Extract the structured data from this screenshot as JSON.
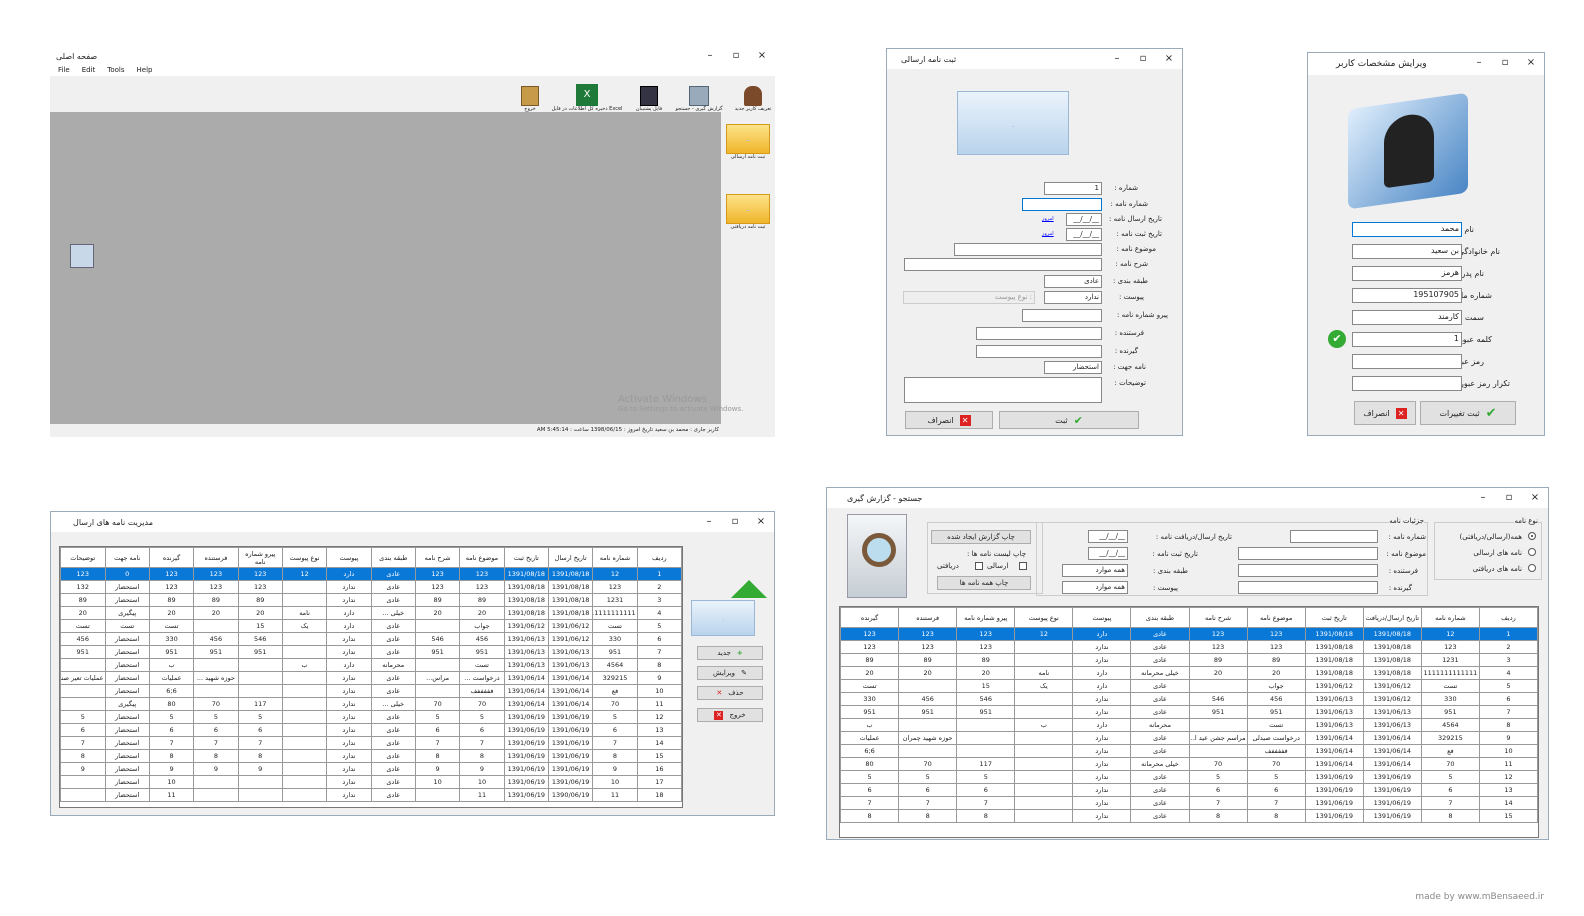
{
  "main": {
    "title": "صفحه اصلی",
    "menu": [
      "File",
      "Edit",
      "Tools",
      "Help"
    ],
    "toolbar": [
      "تعریف کاربر جدید",
      "گزارش گیری - جستجو",
      "فایل پشتیبان",
      "ذخیره کل اطلاعات در فایل Excel",
      "خروج"
    ],
    "side": [
      "ثبت نامه ارسالی",
      "ثبت نامه دریافتی"
    ],
    "watermark1": "Activate Windows",
    "watermark2": "Go to Settings to activate Windows.",
    "status": "کاربر جاری :  محمد بن سعید   تاریخ امروز : 1398/06/15   ساعت : 5:45:14 AM"
  },
  "sendForm": {
    "title": "ثبت نامه ارسالی",
    "labels": [
      "شماره :",
      "شماره نامه :",
      "تاریخ ارسال نامه :",
      "تاریخ ثبت نامه :",
      "موضوع نامه :",
      "شرح نامه :",
      "طبقه بندی :",
      "پیوست :",
      "پیرو شماره نامه :",
      "فرستنده :",
      "گیرنده :",
      "نامه جهت :",
      "توضیحات :"
    ],
    "values": {
      "number": "1",
      "date1": "__/__/__",
      "date2": "__/__/__",
      "classification": "عادی",
      "attach": "ندارد",
      "attachType": "نوع پیوست :",
      "purpose": "استحضار",
      "today": "امروز"
    },
    "submit": "ثبت",
    "cancel": "انصراف"
  },
  "userForm": {
    "title": "ویرایش مشخصات کاربر",
    "labels": [
      "نام :",
      "نام خانوادگی :",
      "نام پدر :",
      "شماره ملی :",
      "سمت :",
      "کلمه عبور :",
      "رمز عبور :",
      "تکرار رمز عبور :"
    ],
    "values": [
      "محمد",
      "بن سعید",
      "هرمز",
      "195107905",
      "کارمند",
      "1",
      "",
      ""
    ],
    "submit": "ثبت تغییرات",
    "cancel": "انصراف"
  },
  "mgmt": {
    "title": "مدیریت نامه های ارسال",
    "headers": [
      "ردیف",
      "شماره نامه",
      "تاریخ ارسال",
      "تاریخ ثبت",
      "موضوع نامه",
      "شرح نامه",
      "طبقه بندی",
      "پیوست",
      "نوع پیوست",
      "پیرو شماره نامه",
      "فرستنده",
      "گیرنده",
      "نامه جهت",
      "توضیحات"
    ],
    "rows": [
      [
        "1",
        "12",
        "1391/08/18",
        "1391/08/18",
        "123",
        "123",
        "عادی",
        "دارد",
        "12",
        "123",
        "123",
        "123",
        "0",
        "123"
      ],
      [
        "2",
        "123",
        "1391/08/18",
        "1391/08/18",
        "123",
        "123",
        "عادی",
        "ندارد",
        "",
        "123",
        "123",
        "123",
        "استحضار",
        "132"
      ],
      [
        "3",
        "1231",
        "1391/08/18",
        "1391/08/18",
        "89",
        "89",
        "عادی",
        "ندارد",
        "",
        "89",
        "89",
        "89",
        "استحضار",
        "89"
      ],
      [
        "4",
        "1111111111111",
        "1391/08/18",
        "1391/08/18",
        "20",
        "20",
        "خیلی ...",
        "دارد",
        "نامه",
        "20",
        "20",
        "20",
        "پیگیری",
        "20"
      ],
      [
        "5",
        "تست",
        "1391/06/12",
        "1391/06/12",
        "جواب",
        "",
        "عادی",
        "دارد",
        "یک",
        "15",
        "",
        "تست",
        "تست",
        "تست"
      ],
      [
        "6",
        "330",
        "1391/06/12",
        "1391/06/13",
        "456",
        "546",
        "عادی",
        "ندارد",
        "",
        "546",
        "456",
        "330",
        "استحضار",
        "456"
      ],
      [
        "7",
        "951",
        "1391/06/13",
        "1391/06/13",
        "951",
        "951",
        "عادی",
        "ندارد",
        "",
        "951",
        "951",
        "951",
        "استحضار",
        "951"
      ],
      [
        "8",
        "4564",
        "1391/06/13",
        "1391/06/13",
        "تست",
        "",
        "محرمانه",
        "دارد",
        "ب",
        "",
        "",
        "ب",
        "استحضار",
        ""
      ],
      [
        "9",
        "329215",
        "1391/06/14",
        "1391/06/14",
        "درخواست ...",
        "مراس...",
        "عادی",
        "ندارد",
        "",
        "",
        "حوزه شهید ...",
        "عملیات",
        "استحضار",
        "عملیات تعیر صنعتی"
      ],
      [
        "10",
        "فع",
        "1391/06/14",
        "1391/06/14",
        "فففففف",
        "",
        "عادی",
        "ندارد",
        "",
        "",
        "",
        "6;6",
        "استحضار",
        ""
      ],
      [
        "11",
        "70",
        "1391/06/14",
        "1391/06/14",
        "70",
        "70",
        "خیلی ...",
        "ندارد",
        "",
        "117",
        "70",
        "80",
        "پیگیری",
        ""
      ],
      [
        "12",
        "5",
        "1391/06/19",
        "1391/06/19",
        "5",
        "5",
        "عادی",
        "ندارد",
        "",
        "5",
        "5",
        "5",
        "استحضار",
        "5"
      ],
      [
        "13",
        "6",
        "1391/06/19",
        "1391/06/19",
        "6",
        "6",
        "عادی",
        "ندارد",
        "",
        "6",
        "6",
        "6",
        "استحضار",
        "6"
      ],
      [
        "14",
        "7",
        "1391/06/19",
        "1391/06/19",
        "7",
        "7",
        "عادی",
        "ندارد",
        "",
        "7",
        "7",
        "7",
        "استحضار",
        "7"
      ],
      [
        "15",
        "8",
        "1391/06/19",
        "1391/06/19",
        "8",
        "8",
        "عادی",
        "ندارد",
        "",
        "8",
        "8",
        "8",
        "استحضار",
        "8"
      ],
      [
        "16",
        "9",
        "1391/06/19",
        "1391/06/19",
        "9",
        "9",
        "عادی",
        "ندارد",
        "",
        "9",
        "9",
        "9",
        "استحضار",
        "9"
      ],
      [
        "17",
        "10",
        "1391/06/19",
        "1391/06/19",
        "10",
        "10",
        "عادی",
        "ندارد",
        "",
        "",
        "",
        "10",
        "استحضار",
        ""
      ],
      [
        "18",
        "11",
        "1390/06/19",
        "1391/06/19",
        "11",
        "",
        "عادی",
        "ندارد",
        "",
        "",
        "",
        "11",
        "استحضار",
        ""
      ]
    ],
    "buttons": [
      "جدید",
      "ویرایش",
      "حذف",
      "خروج"
    ]
  },
  "search": {
    "title": "جستجو - گزارش گیری",
    "groups": [
      "نوع نامه",
      "جزئیات نامه"
    ],
    "radios": [
      "همه(ارسالی/دریافتی)",
      "نامه های ارسالی",
      "نامه های دریافتی"
    ],
    "fields": [
      "شماره نامه :",
      "موضوع نامه :",
      "فرستنده :",
      "گیرنده :",
      "تاریخ ارسال/دریافت نامه :",
      "تاریخ ثبت نامه :",
      "طبقه بندی :",
      "پیوست :"
    ],
    "dateVal": "__/__/__",
    "allVal": "همه موارد",
    "printLabel": "چاپ لیست نامه ها :",
    "checks": [
      "ارسالی",
      "دریافتی"
    ],
    "printBtn": "چاپ گزارش ایجاد شده",
    "printAllBtn": "چاپ همه نامه ها",
    "headers": [
      "ردیف",
      "شماره نامه",
      "تاریخ ارسال/دریافت",
      "تاریخ ثبت",
      "موضوع نامه",
      "شرح نامه",
      "طبقه بندی",
      "پیوست",
      "نوع پیوست",
      "پیرو شماره نامه",
      "فرستنده",
      "گیرنده"
    ],
    "rows": [
      [
        "1",
        "12",
        "1391/08/18",
        "1391/08/18",
        "123",
        "123",
        "عادی",
        "دارد",
        "12",
        "123",
        "123",
        "123"
      ],
      [
        "2",
        "123",
        "1391/08/18",
        "1391/08/18",
        "123",
        "123",
        "عادی",
        "ندارد",
        "",
        "123",
        "123",
        "123"
      ],
      [
        "3",
        "1231",
        "1391/08/18",
        "1391/08/18",
        "89",
        "89",
        "عادی",
        "ندارد",
        "",
        "89",
        "89",
        "89"
      ],
      [
        "4",
        "1111111111111",
        "1391/08/18",
        "1391/08/18",
        "20",
        "20",
        "خیلی محرمانه",
        "دارد",
        "نامه",
        "20",
        "20",
        "20"
      ],
      [
        "5",
        "تست",
        "1391/06/12",
        "1391/06/12",
        "جواب",
        "",
        "عادی",
        "دارد",
        "یک",
        "15",
        "",
        "تست"
      ],
      [
        "6",
        "330",
        "1391/06/12",
        "1391/06/13",
        "456",
        "546",
        "عادی",
        "ندارد",
        "",
        "546",
        "456",
        "330"
      ],
      [
        "7",
        "951",
        "1391/06/13",
        "1391/06/13",
        "951",
        "951",
        "عادی",
        "ندارد",
        "",
        "951",
        "951",
        "951"
      ],
      [
        "8",
        "4564",
        "1391/06/13",
        "1391/06/13",
        "تست",
        "",
        "محرمانه",
        "دارد",
        "ب",
        "",
        "",
        "ب"
      ],
      [
        "9",
        "329215",
        "1391/06/14",
        "1391/06/14",
        "درخواست صیدلی",
        "مراسم جشن عید ا...",
        "عادی",
        "ندارد",
        "",
        "",
        "حوزه شهید چمران",
        "عملیات"
      ],
      [
        "10",
        "فع",
        "1391/06/14",
        "1391/06/14",
        "فففففف",
        "",
        "عادی",
        "ندارد",
        "",
        "",
        "",
        "6;6"
      ],
      [
        "11",
        "70",
        "1391/06/14",
        "1391/06/14",
        "70",
        "70",
        "خیلی محرمانه",
        "ندارد",
        "",
        "117",
        "70",
        "80"
      ],
      [
        "12",
        "5",
        "1391/06/19",
        "1391/06/19",
        "5",
        "5",
        "عادی",
        "ندارد",
        "",
        "5",
        "5",
        "5"
      ],
      [
        "13",
        "6",
        "1391/06/19",
        "1391/06/19",
        "6",
        "6",
        "عادی",
        "ندارد",
        "",
        "6",
        "6",
        "6"
      ],
      [
        "14",
        "7",
        "1391/06/19",
        "1391/06/19",
        "7",
        "7",
        "عادی",
        "ندارد",
        "",
        "7",
        "7",
        "7"
      ],
      [
        "15",
        "8",
        "1391/06/19",
        "1391/06/19",
        "8",
        "8",
        "عادی",
        "ندارد",
        "",
        "8",
        "8",
        "8"
      ]
    ]
  },
  "credit": "made by www.mBensaeed.ir"
}
